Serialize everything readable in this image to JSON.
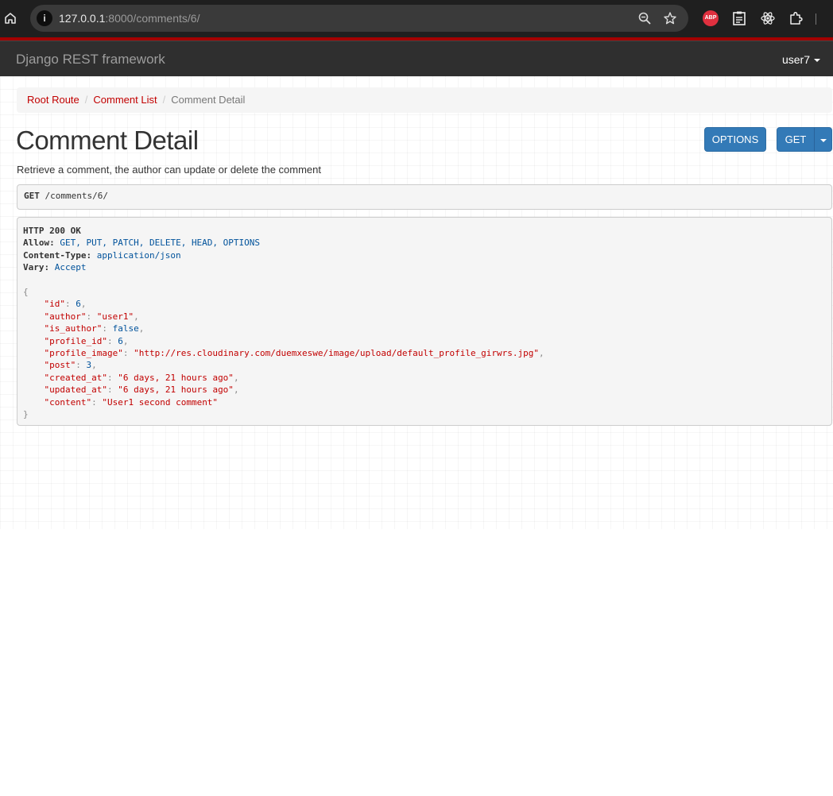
{
  "browser": {
    "url_host": "127.0.0.1",
    "url_path": ":8000/comments/6/",
    "extensions": [
      "adblock-plus-icon",
      "clipboard-icon",
      "react-devtools-icon",
      "extensions-puzzle-icon"
    ],
    "abp_label": "ABP"
  },
  "navbar": {
    "brand": "Django REST framework",
    "user": "user7"
  },
  "breadcrumb": {
    "items": [
      "Root Route",
      "Comment List",
      "Comment Detail"
    ],
    "separator": "/"
  },
  "page": {
    "title": "Comment Detail",
    "description": "Retrieve a comment, the author can update or delete the comment",
    "options_button": "OPTIONS",
    "get_button": "GET"
  },
  "request": {
    "method": "GET",
    "path": " /comments/6/"
  },
  "response": {
    "status": "HTTP 200 OK",
    "headers": [
      {
        "name": "Allow:",
        "value": "GET, PUT, PATCH, DELETE, HEAD, OPTIONS"
      },
      {
        "name": "Content-Type:",
        "value": "application/json"
      },
      {
        "name": "Vary:",
        "value": "Accept"
      }
    ],
    "body": [
      {
        "key": "\"id\"",
        "value": "6",
        "type": "num"
      },
      {
        "key": "\"author\"",
        "value": "\"user1\"",
        "type": "str"
      },
      {
        "key": "\"is_author\"",
        "value": "false",
        "type": "lit"
      },
      {
        "key": "\"profile_id\"",
        "value": "6",
        "type": "num"
      },
      {
        "key": "\"profile_image\"",
        "value": "\"http://res.cloudinary.com/duemxeswe/image/upload/default_profile_girwrs.jpg\"",
        "type": "str"
      },
      {
        "key": "\"post\"",
        "value": "3",
        "type": "num"
      },
      {
        "key": "\"created_at\"",
        "value": "\"6 days, 21 hours ago\"",
        "type": "str"
      },
      {
        "key": "\"updated_at\"",
        "value": "\"6 days, 21 hours ago\"",
        "type": "str"
      },
      {
        "key": "\"content\"",
        "value": "\"User1 second comment\"",
        "type": "str"
      }
    ]
  },
  "colors": {
    "navbar_bg": "#2f2f2f",
    "accent_red": "#a30000",
    "link_red": "#c20000",
    "button_blue": "#337ab7"
  }
}
